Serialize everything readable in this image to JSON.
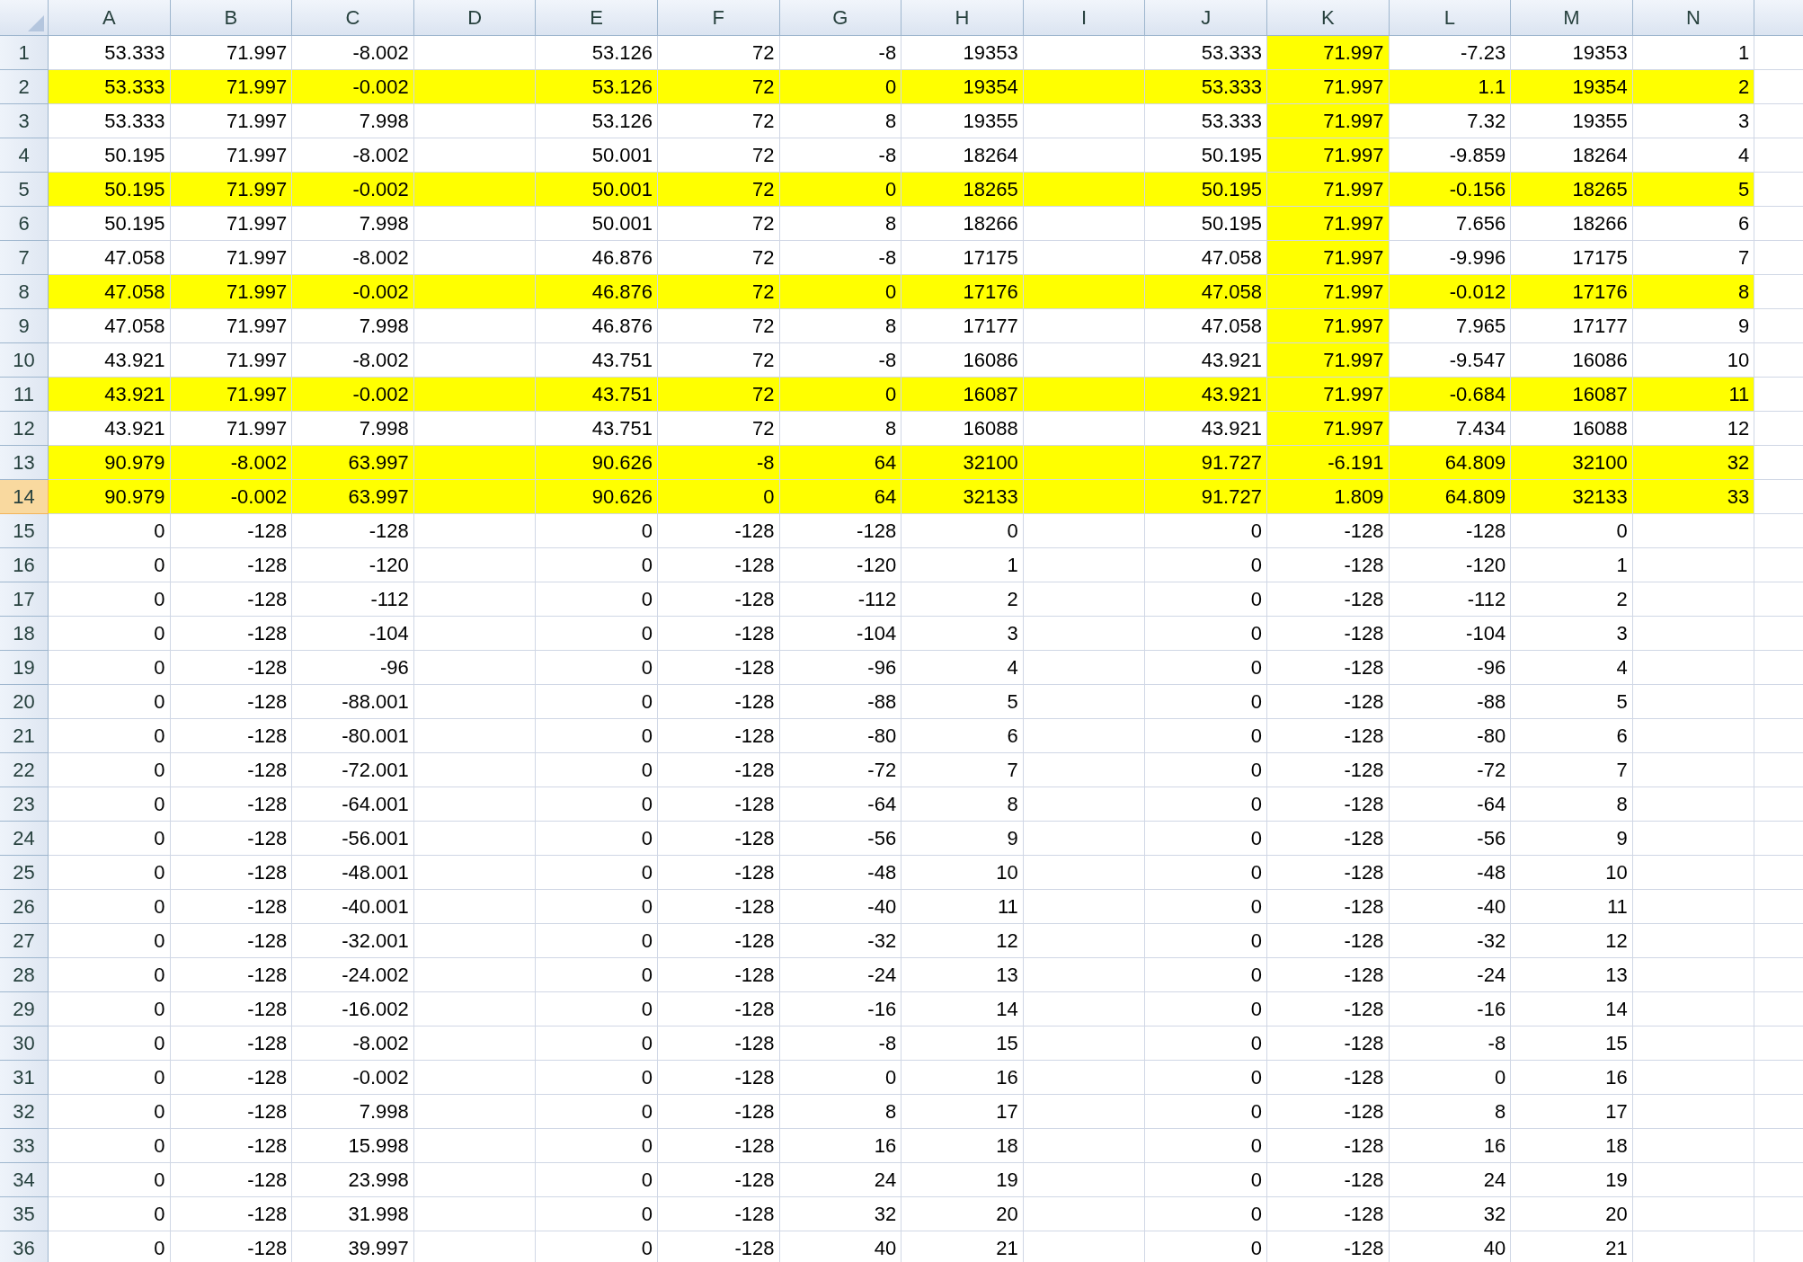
{
  "columns": [
    "A",
    "B",
    "C",
    "D",
    "E",
    "F",
    "G",
    "H",
    "I",
    "J",
    "K",
    "L",
    "M",
    "N"
  ],
  "rows": [
    {
      "n": "1",
      "selected": false,
      "highlighted": false,
      "column_k_highlighted": true,
      "cells": {
        "A": "53.333",
        "B": "71.997",
        "C": "-8.002",
        "E": "53.126",
        "F": "72",
        "G": "-8",
        "H": "19353",
        "J": "53.333",
        "K": "71.997",
        "L": "-7.23",
        "M": "19353",
        "N": "1"
      }
    },
    {
      "n": "2",
      "selected": false,
      "highlighted": true,
      "column_k_highlighted": true,
      "cells": {
        "A": "53.333",
        "B": "71.997",
        "C": "-0.002",
        "E": "53.126",
        "F": "72",
        "G": "0",
        "H": "19354",
        "J": "53.333",
        "K": "71.997",
        "L": "1.1",
        "M": "19354",
        "N": "2"
      }
    },
    {
      "n": "3",
      "selected": false,
      "highlighted": false,
      "column_k_highlighted": true,
      "cells": {
        "A": "53.333",
        "B": "71.997",
        "C": "7.998",
        "E": "53.126",
        "F": "72",
        "G": "8",
        "H": "19355",
        "J": "53.333",
        "K": "71.997",
        "L": "7.32",
        "M": "19355",
        "N": "3"
      }
    },
    {
      "n": "4",
      "selected": false,
      "highlighted": false,
      "column_k_highlighted": true,
      "cells": {
        "A": "50.195",
        "B": "71.997",
        "C": "-8.002",
        "E": "50.001",
        "F": "72",
        "G": "-8",
        "H": "18264",
        "J": "50.195",
        "K": "71.997",
        "L": "-9.859",
        "M": "18264",
        "N": "4"
      }
    },
    {
      "n": "5",
      "selected": false,
      "highlighted": true,
      "column_k_highlighted": true,
      "cells": {
        "A": "50.195",
        "B": "71.997",
        "C": "-0.002",
        "E": "50.001",
        "F": "72",
        "G": "0",
        "H": "18265",
        "J": "50.195",
        "K": "71.997",
        "L": "-0.156",
        "M": "18265",
        "N": "5"
      }
    },
    {
      "n": "6",
      "selected": false,
      "highlighted": false,
      "column_k_highlighted": true,
      "cells": {
        "A": "50.195",
        "B": "71.997",
        "C": "7.998",
        "E": "50.001",
        "F": "72",
        "G": "8",
        "H": "18266",
        "J": "50.195",
        "K": "71.997",
        "L": "7.656",
        "M": "18266",
        "N": "6"
      }
    },
    {
      "n": "7",
      "selected": false,
      "highlighted": false,
      "column_k_highlighted": true,
      "cells": {
        "A": "47.058",
        "B": "71.997",
        "C": "-8.002",
        "E": "46.876",
        "F": "72",
        "G": "-8",
        "H": "17175",
        "J": "47.058",
        "K": "71.997",
        "L": "-9.996",
        "M": "17175",
        "N": "7"
      }
    },
    {
      "n": "8",
      "selected": false,
      "highlighted": true,
      "column_k_highlighted": true,
      "cells": {
        "A": "47.058",
        "B": "71.997",
        "C": "-0.002",
        "E": "46.876",
        "F": "72",
        "G": "0",
        "H": "17176",
        "J": "47.058",
        "K": "71.997",
        "L": "-0.012",
        "M": "17176",
        "N": "8"
      }
    },
    {
      "n": "9",
      "selected": false,
      "highlighted": false,
      "column_k_highlighted": true,
      "cells": {
        "A": "47.058",
        "B": "71.997",
        "C": "7.998",
        "E": "46.876",
        "F": "72",
        "G": "8",
        "H": "17177",
        "J": "47.058",
        "K": "71.997",
        "L": "7.965",
        "M": "17177",
        "N": "9"
      }
    },
    {
      "n": "10",
      "selected": false,
      "highlighted": false,
      "column_k_highlighted": true,
      "cells": {
        "A": "43.921",
        "B": "71.997",
        "C": "-8.002",
        "E": "43.751",
        "F": "72",
        "G": "-8",
        "H": "16086",
        "J": "43.921",
        "K": "71.997",
        "L": "-9.547",
        "M": "16086",
        "N": "10"
      }
    },
    {
      "n": "11",
      "selected": false,
      "highlighted": true,
      "column_k_highlighted": true,
      "cells": {
        "A": "43.921",
        "B": "71.997",
        "C": "-0.002",
        "E": "43.751",
        "F": "72",
        "G": "0",
        "H": "16087",
        "J": "43.921",
        "K": "71.997",
        "L": "-0.684",
        "M": "16087",
        "N": "11"
      }
    },
    {
      "n": "12",
      "selected": false,
      "highlighted": false,
      "column_k_highlighted": true,
      "cells": {
        "A": "43.921",
        "B": "71.997",
        "C": "7.998",
        "E": "43.751",
        "F": "72",
        "G": "8",
        "H": "16088",
        "J": "43.921",
        "K": "71.997",
        "L": "7.434",
        "M": "16088",
        "N": "12"
      }
    },
    {
      "n": "13",
      "selected": false,
      "highlighted": true,
      "column_k_highlighted": true,
      "cells": {
        "A": "90.979",
        "B": "-8.002",
        "C": "63.997",
        "E": "90.626",
        "F": "-8",
        "G": "64",
        "H": "32100",
        "J": "91.727",
        "K": "-6.191",
        "L": "64.809",
        "M": "32100",
        "N": "32"
      }
    },
    {
      "n": "14",
      "selected": true,
      "highlighted": true,
      "column_k_highlighted": true,
      "cells": {
        "A": "90.979",
        "B": "-0.002",
        "C": "63.997",
        "E": "90.626",
        "F": "0",
        "G": "64",
        "H": "32133",
        "J": "91.727",
        "K": "1.809",
        "L": "64.809",
        "M": "32133",
        "N": "33"
      }
    },
    {
      "n": "15",
      "selected": false,
      "highlighted": false,
      "column_k_highlighted": false,
      "cells": {
        "A": "0",
        "B": "-128",
        "C": "-128",
        "E": "0",
        "F": "-128",
        "G": "-128",
        "H": "0",
        "J": "0",
        "K": "-128",
        "L": "-128",
        "M": "0"
      }
    },
    {
      "n": "16",
      "selected": false,
      "highlighted": false,
      "column_k_highlighted": false,
      "cells": {
        "A": "0",
        "B": "-128",
        "C": "-120",
        "E": "0",
        "F": "-128",
        "G": "-120",
        "H": "1",
        "J": "0",
        "K": "-128",
        "L": "-120",
        "M": "1"
      }
    },
    {
      "n": "17",
      "selected": false,
      "highlighted": false,
      "column_k_highlighted": false,
      "cells": {
        "A": "0",
        "B": "-128",
        "C": "-112",
        "E": "0",
        "F": "-128",
        "G": "-112",
        "H": "2",
        "J": "0",
        "K": "-128",
        "L": "-112",
        "M": "2"
      }
    },
    {
      "n": "18",
      "selected": false,
      "highlighted": false,
      "column_k_highlighted": false,
      "cells": {
        "A": "0",
        "B": "-128",
        "C": "-104",
        "E": "0",
        "F": "-128",
        "G": "-104",
        "H": "3",
        "J": "0",
        "K": "-128",
        "L": "-104",
        "M": "3"
      }
    },
    {
      "n": "19",
      "selected": false,
      "highlighted": false,
      "column_k_highlighted": false,
      "cells": {
        "A": "0",
        "B": "-128",
        "C": "-96",
        "E": "0",
        "F": "-128",
        "G": "-96",
        "H": "4",
        "J": "0",
        "K": "-128",
        "L": "-96",
        "M": "4"
      }
    },
    {
      "n": "20",
      "selected": false,
      "highlighted": false,
      "column_k_highlighted": false,
      "cells": {
        "A": "0",
        "B": "-128",
        "C": "-88.001",
        "E": "0",
        "F": "-128",
        "G": "-88",
        "H": "5",
        "J": "0",
        "K": "-128",
        "L": "-88",
        "M": "5"
      }
    },
    {
      "n": "21",
      "selected": false,
      "highlighted": false,
      "column_k_highlighted": false,
      "cells": {
        "A": "0",
        "B": "-128",
        "C": "-80.001",
        "E": "0",
        "F": "-128",
        "G": "-80",
        "H": "6",
        "J": "0",
        "K": "-128",
        "L": "-80",
        "M": "6"
      }
    },
    {
      "n": "22",
      "selected": false,
      "highlighted": false,
      "column_k_highlighted": false,
      "cells": {
        "A": "0",
        "B": "-128",
        "C": "-72.001",
        "E": "0",
        "F": "-128",
        "G": "-72",
        "H": "7",
        "J": "0",
        "K": "-128",
        "L": "-72",
        "M": "7"
      }
    },
    {
      "n": "23",
      "selected": false,
      "highlighted": false,
      "column_k_highlighted": false,
      "cells": {
        "A": "0",
        "B": "-128",
        "C": "-64.001",
        "E": "0",
        "F": "-128",
        "G": "-64",
        "H": "8",
        "J": "0",
        "K": "-128",
        "L": "-64",
        "M": "8"
      }
    },
    {
      "n": "24",
      "selected": false,
      "highlighted": false,
      "column_k_highlighted": false,
      "cells": {
        "A": "0",
        "B": "-128",
        "C": "-56.001",
        "E": "0",
        "F": "-128",
        "G": "-56",
        "H": "9",
        "J": "0",
        "K": "-128",
        "L": "-56",
        "M": "9"
      }
    },
    {
      "n": "25",
      "selected": false,
      "highlighted": false,
      "column_k_highlighted": false,
      "cells": {
        "A": "0",
        "B": "-128",
        "C": "-48.001",
        "E": "0",
        "F": "-128",
        "G": "-48",
        "H": "10",
        "J": "0",
        "K": "-128",
        "L": "-48",
        "M": "10"
      }
    },
    {
      "n": "26",
      "selected": false,
      "highlighted": false,
      "column_k_highlighted": false,
      "cells": {
        "A": "0",
        "B": "-128",
        "C": "-40.001",
        "E": "0",
        "F": "-128",
        "G": "-40",
        "H": "11",
        "J": "0",
        "K": "-128",
        "L": "-40",
        "M": "11"
      }
    },
    {
      "n": "27",
      "selected": false,
      "highlighted": false,
      "column_k_highlighted": false,
      "cells": {
        "A": "0",
        "B": "-128",
        "C": "-32.001",
        "E": "0",
        "F": "-128",
        "G": "-32",
        "H": "12",
        "J": "0",
        "K": "-128",
        "L": "-32",
        "M": "12"
      }
    },
    {
      "n": "28",
      "selected": false,
      "highlighted": false,
      "column_k_highlighted": false,
      "cells": {
        "A": "0",
        "B": "-128",
        "C": "-24.002",
        "E": "0",
        "F": "-128",
        "G": "-24",
        "H": "13",
        "J": "0",
        "K": "-128",
        "L": "-24",
        "M": "13"
      }
    },
    {
      "n": "29",
      "selected": false,
      "highlighted": false,
      "column_k_highlighted": false,
      "cells": {
        "A": "0",
        "B": "-128",
        "C": "-16.002",
        "E": "0",
        "F": "-128",
        "G": "-16",
        "H": "14",
        "J": "0",
        "K": "-128",
        "L": "-16",
        "M": "14"
      }
    },
    {
      "n": "30",
      "selected": false,
      "highlighted": false,
      "column_k_highlighted": false,
      "cells": {
        "A": "0",
        "B": "-128",
        "C": "-8.002",
        "E": "0",
        "F": "-128",
        "G": "-8",
        "H": "15",
        "J": "0",
        "K": "-128",
        "L": "-8",
        "M": "15"
      }
    },
    {
      "n": "31",
      "selected": false,
      "highlighted": false,
      "column_k_highlighted": false,
      "cells": {
        "A": "0",
        "B": "-128",
        "C": "-0.002",
        "E": "0",
        "F": "-128",
        "G": "0",
        "H": "16",
        "J": "0",
        "K": "-128",
        "L": "0",
        "M": "16"
      }
    },
    {
      "n": "32",
      "selected": false,
      "highlighted": false,
      "column_k_highlighted": false,
      "cells": {
        "A": "0",
        "B": "-128",
        "C": "7.998",
        "E": "0",
        "F": "-128",
        "G": "8",
        "H": "17",
        "J": "0",
        "K": "-128",
        "L": "8",
        "M": "17"
      }
    },
    {
      "n": "33",
      "selected": false,
      "highlighted": false,
      "column_k_highlighted": false,
      "cells": {
        "A": "0",
        "B": "-128",
        "C": "15.998",
        "E": "0",
        "F": "-128",
        "G": "16",
        "H": "18",
        "J": "0",
        "K": "-128",
        "L": "16",
        "M": "18"
      }
    },
    {
      "n": "34",
      "selected": false,
      "highlighted": false,
      "column_k_highlighted": false,
      "cells": {
        "A": "0",
        "B": "-128",
        "C": "23.998",
        "E": "0",
        "F": "-128",
        "G": "24",
        "H": "19",
        "J": "0",
        "K": "-128",
        "L": "24",
        "M": "19"
      }
    },
    {
      "n": "35",
      "selected": false,
      "highlighted": false,
      "column_k_highlighted": false,
      "cells": {
        "A": "0",
        "B": "-128",
        "C": "31.998",
        "E": "0",
        "F": "-128",
        "G": "32",
        "H": "20",
        "J": "0",
        "K": "-128",
        "L": "32",
        "M": "20"
      }
    },
    {
      "n": "36",
      "selected": false,
      "highlighted": false,
      "column_k_highlighted": false,
      "cells": {
        "A": "0",
        "B": "-128",
        "C": "39.997",
        "E": "0",
        "F": "-128",
        "G": "40",
        "H": "21",
        "J": "0",
        "K": "-128",
        "L": "40",
        "M": "21"
      }
    }
  ]
}
